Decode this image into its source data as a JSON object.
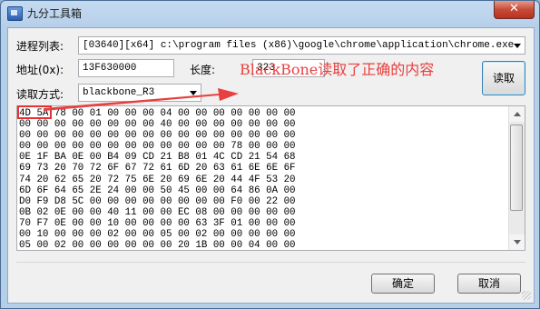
{
  "window": {
    "title": "九分工具箱",
    "close_glyph": "✕"
  },
  "form": {
    "process_label": "进程列表:",
    "process_value": "[03640][x64] c:\\program files (x86)\\google\\chrome\\application\\chrome.exe",
    "address_label": "地址(0x):",
    "address_value": "13F630000",
    "length_label": "长度:",
    "length_value": "323",
    "read_button": "读取",
    "read_mode_label": "读取方式:",
    "read_mode_value": "blackbone_R3"
  },
  "annotation": {
    "text": "BlackBone读取了正确的内容",
    "color": "#e84040"
  },
  "hex_lines": [
    "4D 5A 78 00 01 00 00 00 04 00 00 00 00 00 00 00",
    "00 00 00 00 00 00 00 00 40 00 00 00 00 00 00 00",
    "00 00 00 00 00 00 00 00 00 00 00 00 00 00 00 00",
    "00 00 00 00 00 00 00 00 00 00 00 00 78 00 00 00",
    "0E 1F BA 0E 00 B4 09 CD 21 B8 01 4C CD 21 54 68",
    "69 73 20 70 72 6F 67 72 61 6D 20 63 61 6E 6E 6F",
    "74 20 62 65 20 72 75 6E 20 69 6E 20 44 4F 53 20",
    "6D 6F 64 65 2E 24 00 00 50 45 00 00 64 86 0A 00",
    "D0 F9 D8 5C 00 00 00 00 00 00 00 00 F0 00 22 00",
    "0B 02 0E 00 00 40 11 00 00 EC 08 00 00 00 00 00",
    "70 F7 0E 00 00 10 00 00 00 00 63 3F 01 00 00 00",
    "00 10 00 00 00 02 00 00 05 00 02 00 00 00 00 00",
    "05 00 02 00 00 00 00 00 00 20 1B 00 00 04 00 00"
  ],
  "buttons": {
    "ok": "确定",
    "cancel": "取消"
  }
}
